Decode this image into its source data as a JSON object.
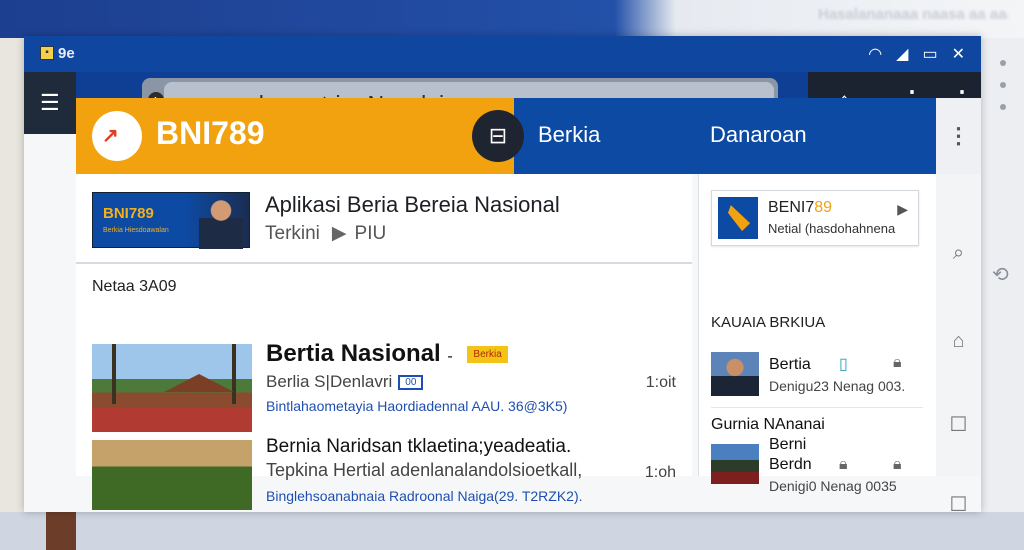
{
  "background": {
    "blurred_text": "Hasalananaaa naasa aa aaa"
  },
  "status_bar": {
    "title": "9e",
    "icons": [
      "wifi-icon",
      "signal-icon",
      "battery-icon",
      "close-icon"
    ]
  },
  "toolbar": {
    "url": "ohenyatriar Nasolgin"
  },
  "brand": {
    "name": "BNI789",
    "nav": [
      "Berkia",
      "Danaroan"
    ],
    "accent": "#f2a20f",
    "primary": "#0d4aa3"
  },
  "hero": {
    "banner_title": "BNI789",
    "banner_sub": "Berkia Hiesdoawalan",
    "title": "Aplikasi Beria Bereia Nasional",
    "subtitle": "Terkini",
    "subtitle_tag": "PIU"
  },
  "news": {
    "section_label": "Netaa 3A09",
    "items": [
      {
        "title": "Bertia Nasional",
        "title_sep": "-",
        "badge": "Berkia",
        "meta": "Berlia S|Denlavri",
        "meta_badge": "00",
        "link": "Bintlahaometayia Haordiadennal AAU. 36@3K5)",
        "time": "1:oit"
      },
      {
        "title": "Bernia Naridsan tklaetina;yeadeatia.",
        "meta": "Tepkina Hertial adenlanalandolsioetkall,",
        "link": "Binglehsoanabnaia Radroonal Naiga(29. T2RZK2).",
        "time": "1:oh"
      }
    ]
  },
  "aside": {
    "card_title_a": "BENI7",
    "card_title_b": "89",
    "card_sub": "Netial (hasdohahnena",
    "label": "KAUAIA BRKIUA",
    "items": [
      {
        "title": "Bertia",
        "sub": "Denigu23 Nenag 003."
      },
      {
        "title_1": "Gurnia NAnanai",
        "title_2": "Berni",
        "title_3": "Berdn",
        "sub": "Denigi0 Nenag 0035"
      }
    ]
  }
}
